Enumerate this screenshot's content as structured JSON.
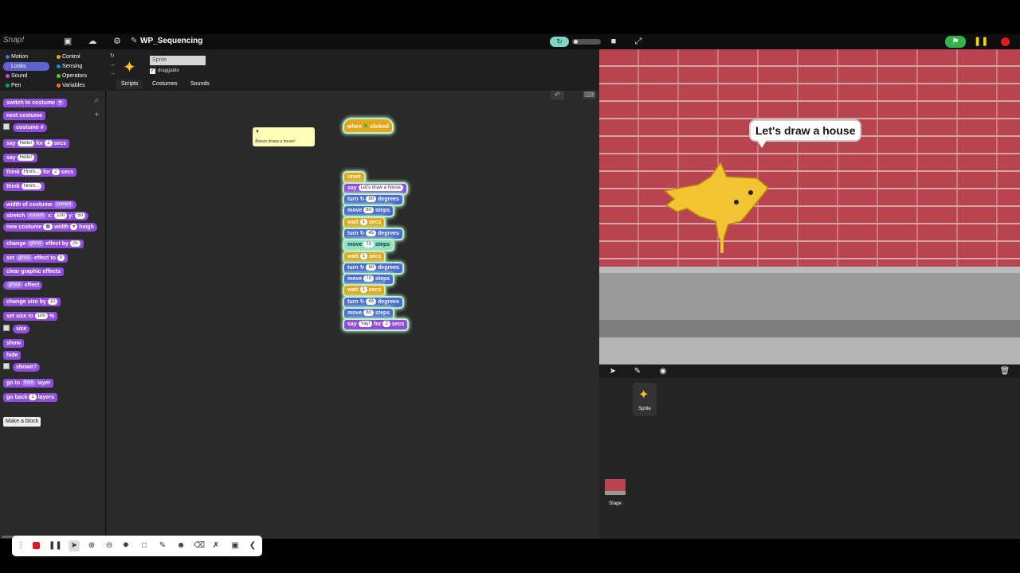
{
  "app": {
    "logo": "Snap!",
    "project_title": "WP_Sequencing"
  },
  "categories": [
    {
      "label": "Motion",
      "color": "#4a6cd4"
    },
    {
      "label": "Control",
      "color": "#e1a91a"
    },
    {
      "label": "Looks",
      "color": "#8f4ee0"
    },
    {
      "label": "Sensing",
      "color": "#0494dc"
    },
    {
      "label": "Sound",
      "color": "#cf4ad9"
    },
    {
      "label": "Operators",
      "color": "#62c213"
    },
    {
      "label": "Pen",
      "color": "#00a178"
    },
    {
      "label": "Variables",
      "color": "#f3761d"
    }
  ],
  "palette": {
    "switch_costume": "switch to costume",
    "next_costume": "next costume",
    "costume_num": "costume #",
    "say_for": {
      "say": "say",
      "msg": "Hello!",
      "for": "for",
      "n": "2",
      "secs": "secs"
    },
    "say": {
      "say": "say",
      "msg": "Hello!"
    },
    "think_for": {
      "think": "think",
      "msg": "Hmm...",
      "for": "for",
      "n": "2",
      "secs": "secs"
    },
    "think": {
      "think": "think",
      "msg": "Hmm..."
    },
    "width_of": {
      "a": "width",
      "b": "of costume",
      "c": "current"
    },
    "stretch": {
      "a": "stretch",
      "b": "current",
      "c": "x:",
      "d": "100",
      "e": "y:",
      "f": "50"
    },
    "new_costume": {
      "a": "new costume",
      "b": "width",
      "c": "heigh"
    },
    "change_effect": {
      "a": "change",
      "b": "ghost",
      "c": "effect by",
      "d": "25"
    },
    "set_effect": {
      "a": "set",
      "b": "ghost",
      "c": "effect to",
      "d": "0"
    },
    "clear_effects": "clear graphic effects",
    "ghost_effect": {
      "a": "ghost",
      "b": "effect"
    },
    "change_size": {
      "a": "change size by",
      "b": "10"
    },
    "set_size": {
      "a": "set size to",
      "b": "100",
      "c": "%"
    },
    "size": "size",
    "show": "show",
    "hide": "hide",
    "shown": "shown?",
    "go_to_layer": {
      "a": "go to",
      "b": "front",
      "c": "layer"
    },
    "go_back": {
      "a": "go back",
      "b": "1",
      "c": "layers"
    },
    "make_block": "Make a block"
  },
  "sprite": {
    "name": "Sprite",
    "draggable_label": "draggable",
    "tabs": [
      "Scripts",
      "Costumes",
      "Sounds"
    ]
  },
  "comment": {
    "text": "Alonzo draws a house!"
  },
  "script": {
    "hat": {
      "a": "when",
      "b": "clicked"
    },
    "reset": "reset",
    "say1": {
      "a": "say",
      "b": "Let's draw a house"
    },
    "blocks": [
      {
        "kind": "turn",
        "a": "turn",
        "dir": "↻",
        "n": "90",
        "b": "degrees"
      },
      {
        "kind": "move",
        "a": "move",
        "n": "80",
        "b": "steps"
      },
      {
        "kind": "wait",
        "a": "wait",
        "n": "1",
        "b": "secs"
      },
      {
        "kind": "turn",
        "a": "turn",
        "dir": "↻",
        "n": "45",
        "b": "degrees"
      },
      {
        "kind": "move",
        "a": "move",
        "n": "70",
        "b": "steps"
      },
      {
        "kind": "wait",
        "a": "wait",
        "n": "1",
        "b": "secs"
      },
      {
        "kind": "turn",
        "a": "turn",
        "dir": "↻",
        "n": "90",
        "b": "degrees"
      },
      {
        "kind": "move",
        "a": "move",
        "n": "70",
        "b": "steps"
      },
      {
        "kind": "wait",
        "a": "wait",
        "n": "1",
        "b": "secs"
      },
      {
        "kind": "turn",
        "a": "turn",
        "dir": "↻",
        "n": "45",
        "b": "degrees"
      },
      {
        "kind": "move",
        "a": "move",
        "n": "80",
        "b": "steps"
      }
    ],
    "say_last": {
      "a": "say",
      "b": "Yay!",
      "c": "for",
      "n": "2",
      "d": "secs"
    }
  },
  "stage": {
    "speech": "Let's draw a house"
  },
  "corral": {
    "sprite_label": "Sprite",
    "stage_label": "Stage"
  }
}
